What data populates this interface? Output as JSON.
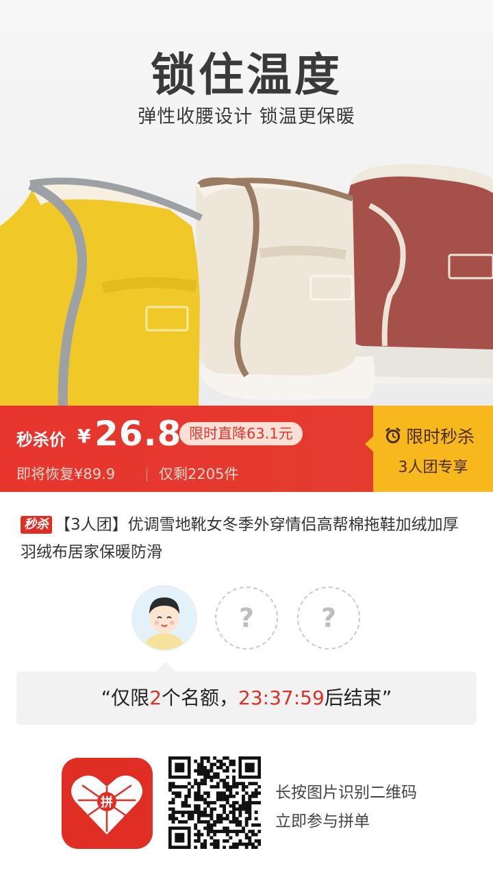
{
  "hero": {
    "title": "锁住温度",
    "subtitle": "弹性收腰设计 锁温更保暖",
    "boot_colors": [
      "#f0c928",
      "#eee6d8",
      "#a55149"
    ]
  },
  "banner": {
    "price_label": "秒杀价",
    "currency": "¥",
    "price": "26.8",
    "drop_text": "限时直降63.1元",
    "restore_text": "即将恢复¥89.9",
    "stock_text": "仅剩2205件",
    "flash_title": "限时秒杀",
    "group_text": "3人团专享",
    "colors": {
      "red": "#e7352d",
      "yellow": "#f6b81c"
    }
  },
  "product": {
    "badge": "秒杀",
    "title": "【3人团】优调雪地靴女冬季外穿情侣高帮棉拖鞋加绒加厚羽绒布居家保暖防滑"
  },
  "group": {
    "empty_slot_mark": "?",
    "quote_open": "“仅限",
    "slots_left": "2",
    "quote_mid": "个名额，",
    "countdown": "23:37:59",
    "quote_close": "后结束”"
  },
  "footer": {
    "app_logo_text": "拼",
    "hint_line1": "长按图片识别二维码",
    "hint_line2": "立即参与拼单"
  }
}
